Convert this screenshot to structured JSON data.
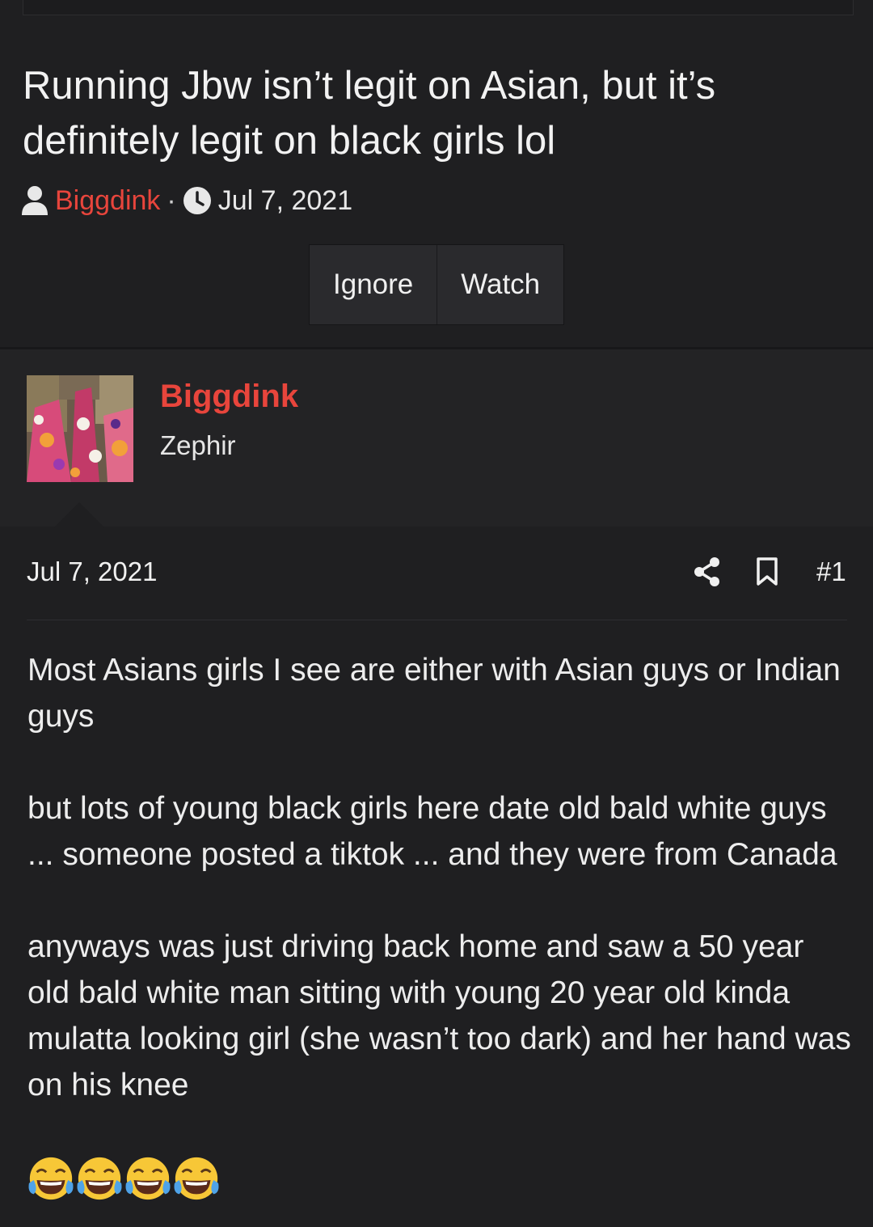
{
  "thread": {
    "title": "Running Jbw isn’t legit on Asian, but it’s definitely legit on black girls lol",
    "author": "Biggdink",
    "separator": "·",
    "date": "Jul 7, 2021",
    "buttons": {
      "ignore": "Ignore",
      "watch": "Watch"
    }
  },
  "post": {
    "username": "Biggdink",
    "user_title": "Zephir",
    "date": "Jul 7, 2021",
    "number": "#1",
    "paragraphs": [
      "Most Asians girls I see are either with Asian guys or Indian guys",
      "but lots of young black girls here date old bald white guys ... someone posted a tiktok ... and they were from Canada",
      "anyways was just driving back home and saw a 50 year old bald white man sitting with young 20 year old kinda mulatta looking girl (she wasn’t too dark) and her hand was on his knee"
    ],
    "emoji": [
      "face-with-tears-of-joy",
      "face-with-tears-of-joy",
      "face-with-tears-of-joy",
      "face-with-tears-of-joy"
    ]
  },
  "colors": {
    "background": "#1f1f21",
    "accent": "#e8453c",
    "text": "#eeeeee",
    "button_bg": "#2a2a2d"
  }
}
